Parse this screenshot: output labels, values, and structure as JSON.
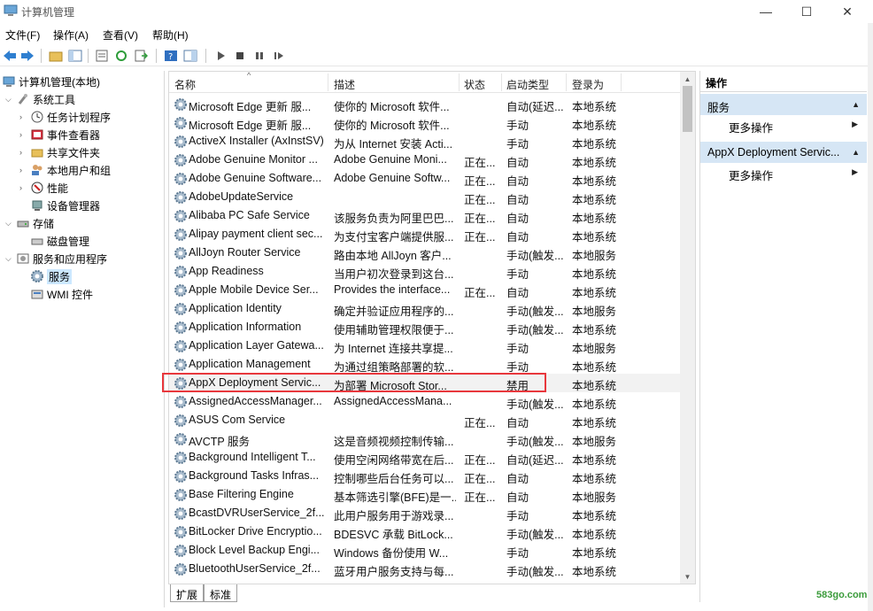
{
  "window": {
    "title": "计算机管理",
    "min": "—",
    "max": "☐",
    "close": "✕"
  },
  "menu": [
    "文件(F)",
    "操作(A)",
    "查看(V)",
    "帮助(H)"
  ],
  "tree": {
    "root": "计算机管理(本地)",
    "system_tools": "系统工具",
    "task_scheduler": "任务计划程序",
    "event_viewer": "事件查看器",
    "shared_folders": "共享文件夹",
    "local_users": "本地用户和组",
    "performance": "性能",
    "device_manager": "设备管理器",
    "storage": "存储",
    "disk_management": "磁盘管理",
    "services_apps": "服务和应用程序",
    "services": "服务",
    "wmi": "WMI 控件"
  },
  "columns": {
    "name": "名称",
    "desc": "描述",
    "status": "状态",
    "startup": "启动类型",
    "logon": "登录为"
  },
  "services": [
    {
      "name": "Microsoft Edge 更新 服...",
      "desc": "使你的 Microsoft 软件...",
      "status": "",
      "startup": "自动(延迟...",
      "logon": "本地系统"
    },
    {
      "name": "Microsoft Edge 更新 服...",
      "desc": "使你的 Microsoft 软件...",
      "status": "",
      "startup": "手动",
      "logon": "本地系统"
    },
    {
      "name": "ActiveX Installer (AxInstSV)",
      "desc": "为从 Internet 安装 Acti...",
      "status": "",
      "startup": "手动",
      "logon": "本地系统"
    },
    {
      "name": "Adobe Genuine Monitor ...",
      "desc": "Adobe Genuine Moni...",
      "status": "正在...",
      "startup": "自动",
      "logon": "本地系统"
    },
    {
      "name": "Adobe Genuine Software...",
      "desc": "Adobe Genuine Softw...",
      "status": "正在...",
      "startup": "自动",
      "logon": "本地系统"
    },
    {
      "name": "AdobeUpdateService",
      "desc": "",
      "status": "正在...",
      "startup": "自动",
      "logon": "本地系统"
    },
    {
      "name": "Alibaba PC Safe Service",
      "desc": "该服务负责为阿里巴巴...",
      "status": "正在...",
      "startup": "自动",
      "logon": "本地系统"
    },
    {
      "name": "Alipay payment client sec...",
      "desc": "为支付宝客户端提供服...",
      "status": "正在...",
      "startup": "自动",
      "logon": "本地系统"
    },
    {
      "name": "AllJoyn Router Service",
      "desc": "路由本地 AllJoyn 客户...",
      "status": "",
      "startup": "手动(触发...",
      "logon": "本地服务"
    },
    {
      "name": "App Readiness",
      "desc": "当用户初次登录到这台...",
      "status": "",
      "startup": "手动",
      "logon": "本地系统"
    },
    {
      "name": "Apple Mobile Device Ser...",
      "desc": "Provides the interface...",
      "status": "正在...",
      "startup": "自动",
      "logon": "本地系统"
    },
    {
      "name": "Application Identity",
      "desc": "确定并验证应用程序的...",
      "status": "",
      "startup": "手动(触发...",
      "logon": "本地服务"
    },
    {
      "name": "Application Information",
      "desc": "使用辅助管理权限便于...",
      "status": "",
      "startup": "手动(触发...",
      "logon": "本地系统"
    },
    {
      "name": "Application Layer Gatewa...",
      "desc": "为 Internet 连接共享提...",
      "status": "",
      "startup": "手动",
      "logon": "本地服务"
    },
    {
      "name": "Application Management",
      "desc": "为通过组策略部署的软...",
      "status": "",
      "startup": "手动",
      "logon": "本地系统"
    },
    {
      "name": "AppX Deployment Servic...",
      "desc": "为部署 Microsoft Stor...",
      "status": "",
      "startup": "禁用",
      "logon": "本地系统"
    },
    {
      "name": "AssignedAccessManager...",
      "desc": "AssignedAccessMana...",
      "status": "",
      "startup": "手动(触发...",
      "logon": "本地系统"
    },
    {
      "name": "ASUS Com Service",
      "desc": "",
      "status": "正在...",
      "startup": "自动",
      "logon": "本地系统"
    },
    {
      "name": "AVCTP 服务",
      "desc": "这是音频视频控制传输...",
      "status": "",
      "startup": "手动(触发...",
      "logon": "本地服务"
    },
    {
      "name": "Background Intelligent T...",
      "desc": "使用空闲网络带宽在后...",
      "status": "正在...",
      "startup": "自动(延迟...",
      "logon": "本地系统"
    },
    {
      "name": "Background Tasks Infras...",
      "desc": "控制哪些后台任务可以...",
      "status": "正在...",
      "startup": "自动",
      "logon": "本地系统"
    },
    {
      "name": "Base Filtering Engine",
      "desc": "基本筛选引擎(BFE)是一...",
      "status": "正在...",
      "startup": "自动",
      "logon": "本地服务"
    },
    {
      "name": "BcastDVRUserService_2f...",
      "desc": "此用户服务用于游戏录...",
      "status": "",
      "startup": "手动",
      "logon": "本地系统"
    },
    {
      "name": "BitLocker Drive Encryptio...",
      "desc": "BDESVC 承载 BitLock...",
      "status": "",
      "startup": "手动(触发...",
      "logon": "本地系统"
    },
    {
      "name": "Block Level Backup Engi...",
      "desc": "Windows 备份使用 W...",
      "status": "",
      "startup": "手动",
      "logon": "本地系统"
    },
    {
      "name": "BluetoothUserService_2f...",
      "desc": "蓝牙用户服务支持与每...",
      "status": "",
      "startup": "手动(触发...",
      "logon": "本地系统"
    }
  ],
  "tabs": [
    "扩展",
    "标准"
  ],
  "actions": {
    "header": "操作",
    "section1": "服务",
    "more1": "更多操作",
    "section2": "AppX Deployment Servic...",
    "more2": "更多操作"
  },
  "watermark": "583go.com"
}
